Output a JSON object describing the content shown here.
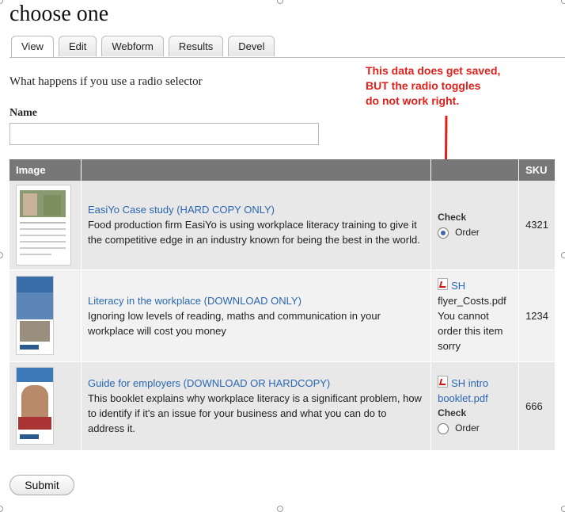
{
  "page": {
    "title": "choose one"
  },
  "tabs": [
    {
      "label": "View"
    },
    {
      "label": "Edit"
    },
    {
      "label": "Webform"
    },
    {
      "label": "Results"
    },
    {
      "label": "Devel"
    }
  ],
  "intro": "What happens if you use a radio selector",
  "annotation": {
    "lines": [
      "This data does get saved,",
      "BUT the radio toggles",
      "do not work right."
    ],
    "color": "#e0201b"
  },
  "form": {
    "name_label": "Name",
    "name_value": "",
    "submit_label": "Submit"
  },
  "table": {
    "headers": [
      "Image",
      "",
      "",
      "SKU"
    ],
    "rows": [
      {
        "title": "EasiYo Case study (HARD COPY ONLY)",
        "description": "Food production firm EasiYo is using workplace literacy training to give it the competitive edge in an industry known for being the best in the world.",
        "check_label": "Check",
        "order_label": "Order",
        "order_selected": true,
        "sku": "4321"
      },
      {
        "title": "Literacy in the workplace (DOWNLOAD ONLY)",
        "description": "Ignoring low levels of reading, maths and communication in your workplace will cost you money",
        "file_line1": "SH",
        "file_line2": "flyer_Costs.pdf",
        "note": "You cannot order this item sorry",
        "sku": "1234"
      },
      {
        "title": "Guide for employers (DOWNLOAD OR HARDCOPY)",
        "description": "This booklet explains why workplace literacy is a significant problem, how to identify if it's an issue for your business and what you can do to address it.",
        "file_line1": "SH intro",
        "file_line2": "booklet.pdf",
        "check_label": "Check",
        "order_label": "Order",
        "order_selected": false,
        "sku": "666"
      }
    ]
  },
  "colors": {
    "link": "#2a67b1",
    "header_bg": "#777777",
    "radio_selected": "#3f64b7"
  }
}
